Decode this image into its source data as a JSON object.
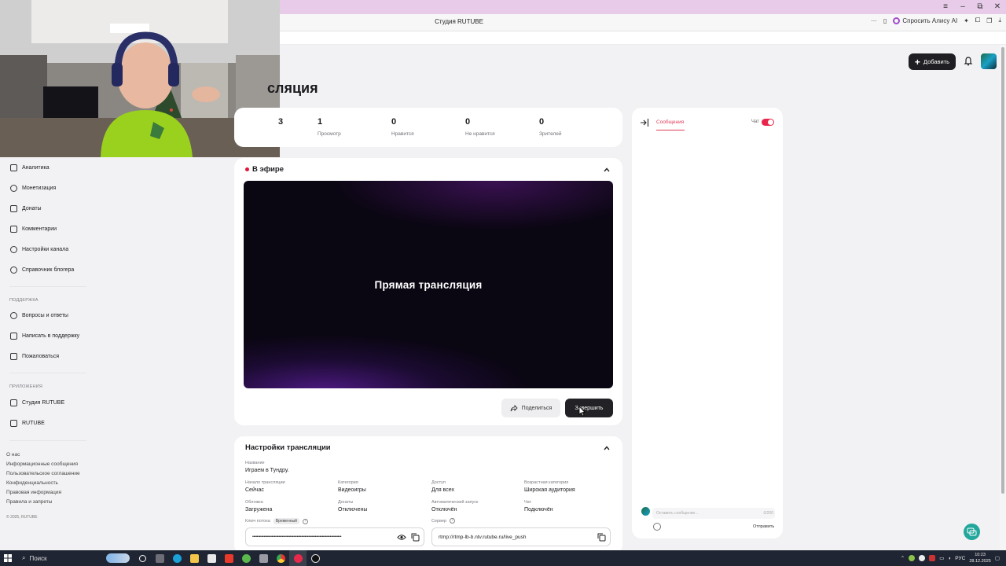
{
  "browser": {
    "tab_title": "Студия RUTUBE",
    "alisa_label": "Спросить Алису AI",
    "window_controls": [
      "≡",
      "–",
      "⧉",
      "✕"
    ],
    "accent_color": "#e7cbe9"
  },
  "header": {
    "add_button": "Добавить",
    "add_icon": "+"
  },
  "page": {
    "title_visible": "сляция"
  },
  "stats": [
    {
      "value": "3",
      "label": ""
    },
    {
      "value": "1",
      "label": "Просмотр"
    },
    {
      "value": "0",
      "label": "Нравится"
    },
    {
      "value": "0",
      "label": "Не нравится"
    },
    {
      "value": "0",
      "label": "Зрителей"
    }
  ],
  "live": {
    "status": "В эфире",
    "player_title": "Прямая трансляция",
    "share_button": "Поделиться",
    "end_button": "Завершить",
    "live_color": "#e2153a"
  },
  "settings": {
    "title": "Настройки трансляции",
    "name_label": "Название",
    "name_value": "Играем в Тундру.",
    "fields": [
      {
        "label": "Начало трансляции",
        "value": "Сейчас"
      },
      {
        "label": "Категория",
        "value": "Видеоигры"
      },
      {
        "label": "Доступ",
        "value": "Для всех"
      },
      {
        "label": "Возрастная категория",
        "value": "Широкая аудитория"
      },
      {
        "label": "Обложка",
        "value": "Загружена"
      },
      {
        "label": "Донаты",
        "value": "Отключены"
      },
      {
        "label": "Автоматический запуск",
        "value": "Отключён"
      },
      {
        "label": "Чат",
        "value": "Подключён"
      }
    ],
    "stream_key_label": "Ключ потока",
    "stream_key_badge": "Временный",
    "stream_key_value": "••••••••••••••••••••••••••••••••••••••••••••••••••••••••••••••••••••••••••••••",
    "server_label": "Сервер",
    "server_value": "rtmp://rtmp-lb-b.ntv.rutube.ru/live_push"
  },
  "chat": {
    "tab_messages": "Сообщения",
    "toggle_label": "Чат",
    "toggle_on": true,
    "input_placeholder": "Оставить сообщение...",
    "counter": "0/200",
    "send_button": "Отправить",
    "accent_color": "#e03c59"
  },
  "sidebar": {
    "items": [
      {
        "label": "Аналитика",
        "icon": "chart-icon"
      },
      {
        "label": "Монетизация",
        "icon": "coin-icon"
      },
      {
        "label": "Донаты",
        "icon": "wallet-icon"
      },
      {
        "label": "Комментарии",
        "icon": "comment-icon"
      },
      {
        "label": "Настройки канала",
        "icon": "gear-icon"
      },
      {
        "label": "Справочник блогера",
        "icon": "info-icon"
      }
    ],
    "support_section": "ПОДДЕРЖКА",
    "support_items": [
      {
        "label": "Вопросы и ответы",
        "icon": "question-icon"
      },
      {
        "label": "Написать в поддержку",
        "icon": "mail-icon"
      },
      {
        "label": "Пожаловаться",
        "icon": "flag-icon"
      }
    ],
    "apps_section": "ПРИЛОЖЕНИЯ",
    "apps_items": [
      {
        "label": "Студия RUTUBE",
        "icon": "studio-icon"
      },
      {
        "label": "RUTUBE",
        "icon": "rutube-icon"
      }
    ],
    "footer_links": [
      "О нас",
      "Информационные сообщения",
      "Пользовательское соглашение",
      "Конфиденциальность",
      "Правовая информация",
      "Правила и запреты"
    ],
    "copyright": "© 2025, RUTUBE"
  },
  "taskbar": {
    "search_label": "Поиск",
    "lang": "РУС",
    "time": "10:23",
    "date": "28.12.2025"
  }
}
